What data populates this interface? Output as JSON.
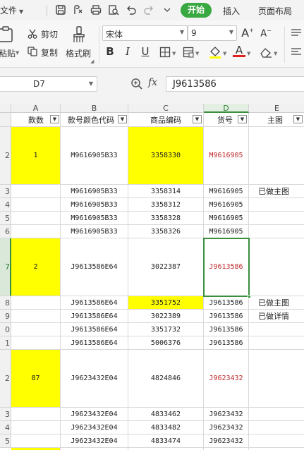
{
  "menu": {
    "file_label": "文件",
    "tabs": [
      {
        "label": "开始",
        "active": true
      },
      {
        "label": "插入",
        "active": false
      },
      {
        "label": "页面布局",
        "active": false
      }
    ]
  },
  "ribbon": {
    "paste_label": "粘贴",
    "cut_label": "剪切",
    "copy_label": "复制",
    "format_painter_label": "格式刷",
    "font_name": "宋体",
    "font_size": "9",
    "font_grow": "A",
    "font_shrink": "A",
    "bold": "B",
    "italic": "I",
    "underline": "U",
    "font_color_glyph": "A"
  },
  "formula_bar": {
    "name_box": "D7",
    "fx_label": "fx",
    "formula": "J9613586"
  },
  "colors": {
    "accent": "#38a840",
    "highlight": "#ffff00",
    "red_text": "#c0282a"
  },
  "sheet": {
    "columns": [
      "A",
      "B",
      "C",
      "D",
      "E"
    ],
    "row_numbers": [
      "",
      "2",
      "3",
      "4",
      "5",
      "6",
      "7",
      "8",
      "9",
      "0",
      "1",
      "2",
      "3",
      "4",
      "5"
    ],
    "header_row": {
      "A": "款数",
      "B": "款号颜色代码",
      "C": "商品编码",
      "D": "货号",
      "E": "主图"
    },
    "rows": [
      {
        "A": "1",
        "B": "M9616905B33",
        "C": "3358330",
        "D": "M9616905",
        "E": ""
      },
      {
        "A": "",
        "B": "M9616905B33",
        "C": "3358314",
        "D": "M9616905",
        "E": "已做主图"
      },
      {
        "A": "",
        "B": "M9616905B33",
        "C": "3358312",
        "D": "M9616905",
        "E": ""
      },
      {
        "A": "",
        "B": "M9616905B33",
        "C": "3358328",
        "D": "M9616905",
        "E": ""
      },
      {
        "A": "",
        "B": "M9616905B33",
        "C": "3358326",
        "D": "M9616905",
        "E": ""
      },
      {
        "A": "2",
        "B": "J9613586E64",
        "C": "3022387",
        "D": "J9613586",
        "E": ""
      },
      {
        "A": "",
        "B": "J9613586E64",
        "C": "3351752",
        "D": "J9613586",
        "E": "已做主图"
      },
      {
        "A": "",
        "B": "J9613586E64",
        "C": "3022389",
        "D": "J9613586",
        "E": "已做详情"
      },
      {
        "A": "",
        "B": "J9613586E64",
        "C": "3351732",
        "D": "J9613586",
        "E": ""
      },
      {
        "A": "",
        "B": "J9613586E64",
        "C": "5006376",
        "D": "J9613586",
        "E": ""
      },
      {
        "A": "87",
        "B": "J9623432E04",
        "C": "4824846",
        "D": "J9623432",
        "E": ""
      },
      {
        "A": "",
        "B": "J9623432E04",
        "C": "4833462",
        "D": "J9623432",
        "E": ""
      },
      {
        "A": "",
        "B": "J9623432E04",
        "C": "4833482",
        "D": "J9623432",
        "E": ""
      },
      {
        "A": "",
        "B": "J9623432E04",
        "C": "4833474",
        "D": "J9623432",
        "E": ""
      }
    ]
  }
}
